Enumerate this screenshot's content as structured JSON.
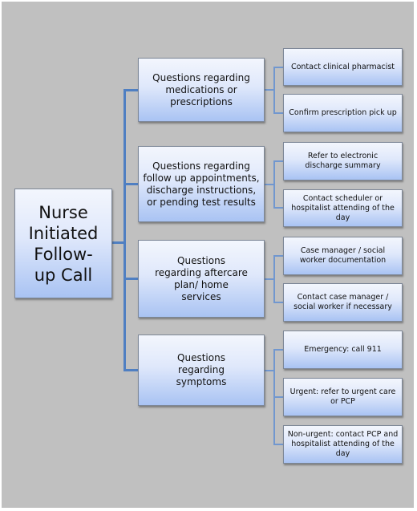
{
  "diagram": {
    "root": {
      "label": "Nurse Initiated Follow-up Call"
    },
    "branches": [
      {
        "label": "Questions regarding medications or prescriptions",
        "actions": [
          {
            "label": "Contact clinical pharmacist"
          },
          {
            "label": "Confirm prescription pick up"
          }
        ]
      },
      {
        "label": "Questions regarding follow up appointments, discharge instructions, or pending test results",
        "actions": [
          {
            "label": "Refer to electronic discharge summary"
          },
          {
            "label": "Contact scheduler or hospitalist attending of the day"
          }
        ]
      },
      {
        "label": "Questions regarding aftercare plan/ home services",
        "actions": [
          {
            "label": "Case manager / social worker documentation"
          },
          {
            "label": "Contact case manager / social worker if necessary"
          }
        ]
      },
      {
        "label": "Questions regarding symptoms",
        "actions": [
          {
            "label": "Emergency: call 911"
          },
          {
            "label": "Urgent: refer to  urgent care or PCP"
          },
          {
            "label": "Non-urgent: contact PCP and hospitalist attending of the day"
          }
        ]
      }
    ],
    "colors": {
      "background": "#c0c0c0",
      "connector": "#4f7fc2",
      "box_fill_top": "#f3f6fd",
      "box_fill_bottom": "#a9c3f3"
    }
  }
}
